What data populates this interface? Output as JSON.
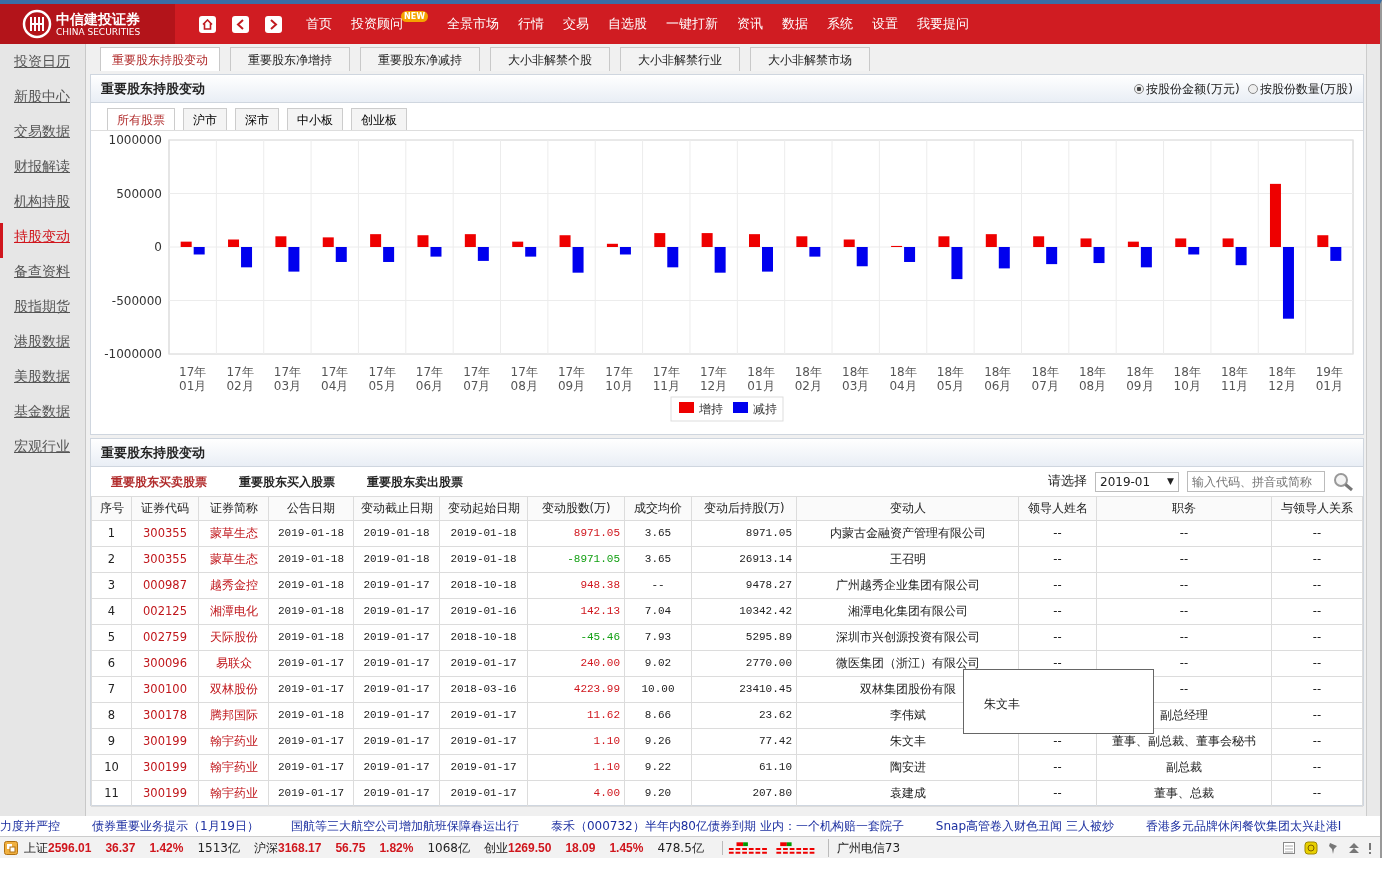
{
  "header": {
    "logo": {
      "name": "中信建投证券",
      "subtitle": "CHINA SECURITIES"
    },
    "nav": [
      {
        "label": "首页"
      },
      {
        "label": "投资顾问",
        "badge": "NEW"
      },
      {
        "label": "全景市场"
      },
      {
        "label": "行情"
      },
      {
        "label": "交易"
      },
      {
        "label": "自选股"
      },
      {
        "label": "一键打新"
      },
      {
        "label": "资讯"
      },
      {
        "label": "数据"
      },
      {
        "label": "系统"
      },
      {
        "label": "设置"
      },
      {
        "label": "我要提问"
      }
    ]
  },
  "sidebar": {
    "items": [
      {
        "label": "投资日历",
        "selected": false
      },
      {
        "label": "新股中心",
        "selected": false
      },
      {
        "label": "交易数据",
        "selected": false
      },
      {
        "label": "财报解读",
        "selected": false
      },
      {
        "label": "机构持股",
        "selected": false
      },
      {
        "label": "持股变动",
        "selected": true
      },
      {
        "label": "备查资料",
        "selected": false
      },
      {
        "label": "股指期货",
        "selected": false
      },
      {
        "label": "港股数据",
        "selected": false
      },
      {
        "label": "美股数据",
        "selected": false
      },
      {
        "label": "基金数据",
        "selected": false
      },
      {
        "label": "宏观行业",
        "selected": false
      }
    ]
  },
  "tabs": [
    {
      "label": "重要股东持股变动",
      "selected": true
    },
    {
      "label": "重要股东净增持",
      "selected": false
    },
    {
      "label": "重要股东净减持",
      "selected": false
    },
    {
      "label": "大小非解禁个股",
      "selected": false
    },
    {
      "label": "大小非解禁行业",
      "selected": false
    },
    {
      "label": "大小非解禁市场",
      "selected": false
    }
  ],
  "chart_panel": {
    "title": "重要股东持股变动",
    "options": [
      {
        "label": "按股份金额(万元)",
        "selected": true
      },
      {
        "label": "按股份数量(万股)",
        "selected": false
      }
    ],
    "market_tabs": [
      {
        "label": "所有股票",
        "selected": true
      },
      {
        "label": "沪市",
        "selected": false
      },
      {
        "label": "深市",
        "selected": false
      },
      {
        "label": "中小板",
        "selected": false
      },
      {
        "label": "创业板",
        "selected": false
      }
    ],
    "chart_data": {
      "type": "bar",
      "categories": [
        "17年01月",
        "17年02月",
        "17年03月",
        "17年04月",
        "17年05月",
        "17年06月",
        "17年07月",
        "17年08月",
        "17年09月",
        "17年10月",
        "17年11月",
        "17年12月",
        "18年01月",
        "18年02月",
        "18年03月",
        "18年04月",
        "18年05月",
        "18年06月",
        "18年07月",
        "18年08月",
        "18年09月",
        "18年10月",
        "18年11月",
        "18年12月",
        "19年01月"
      ],
      "series": [
        {
          "name": "增持",
          "color": "#ee0000",
          "values": [
            50000,
            70000,
            100000,
            90000,
            120000,
            110000,
            120000,
            50000,
            110000,
            30000,
            130000,
            130000,
            120000,
            100000,
            70000,
            10000,
            100000,
            120000,
            100000,
            80000,
            50000,
            80000,
            80000,
            590000,
            110000
          ]
        },
        {
          "name": "减持",
          "color": "#0000ee",
          "values": [
            -70000,
            -190000,
            -230000,
            -140000,
            -140000,
            -90000,
            -130000,
            -90000,
            -240000,
            -70000,
            -190000,
            -240000,
            -230000,
            -90000,
            -180000,
            -140000,
            -300000,
            -200000,
            -160000,
            -150000,
            -190000,
            -70000,
            -170000,
            -670000,
            -130000
          ]
        }
      ],
      "ylim": [
        -1000000,
        1000000
      ],
      "yticks": [
        1000000,
        500000,
        0,
        -500000,
        -1000000
      ],
      "grid": true,
      "legend": true
    }
  },
  "table_panel": {
    "title": "重要股东持股变动",
    "filter_tabs": [
      {
        "label": "重要股东买卖股票",
        "selected": true
      },
      {
        "label": "重要股东买入股票",
        "selected": false
      },
      {
        "label": "重要股东卖出股票",
        "selected": false
      }
    ],
    "select_label": "请选择",
    "select_value": "2019-01",
    "select_caret": "▼",
    "search_placeholder": "输入代码、拼音或简称",
    "columns": [
      "序号",
      "证券代码",
      "证券简称",
      "公告日期",
      "变动截止日期",
      "变动起始日期",
      "变动股数(万)",
      "成交均价",
      "变动后持股(万)",
      "变动人",
      "领导人姓名",
      "职务",
      "与领导人关系"
    ],
    "rows": [
      {
        "no": "1",
        "code": "300355",
        "name": "蒙草生态",
        "announce": "2019-01-18",
        "end": "2019-01-18",
        "start": "2019-01-18",
        "change": "8971.05",
        "kind": "increase",
        "price": "3.65",
        "after": "8971.05",
        "holder": "内蒙古金融资产管理有限公司",
        "leader": "--",
        "title": "--",
        "relation": "--"
      },
      {
        "no": "2",
        "code": "300355",
        "name": "蒙草生态",
        "announce": "2019-01-18",
        "end": "2019-01-18",
        "start": "2019-01-18",
        "change": "-8971.05",
        "kind": "decrease",
        "price": "3.65",
        "after": "26913.14",
        "holder": "王召明",
        "leader": "--",
        "title": "--",
        "relation": "--"
      },
      {
        "no": "3",
        "code": "000987",
        "name": "越秀金控",
        "announce": "2019-01-18",
        "end": "2019-01-17",
        "start": "2018-10-18",
        "change": "948.38",
        "kind": "increase",
        "price": "--",
        "after": "9478.27",
        "holder": "广州越秀企业集团有限公司",
        "leader": "--",
        "title": "--",
        "relation": "--"
      },
      {
        "no": "4",
        "code": "002125",
        "name": "湘潭电化",
        "announce": "2019-01-18",
        "end": "2019-01-17",
        "start": "2019-01-16",
        "change": "142.13",
        "kind": "increase",
        "price": "7.04",
        "after": "10342.42",
        "holder": "湘潭电化集团有限公司",
        "leader": "--",
        "title": "--",
        "relation": "--"
      },
      {
        "no": "5",
        "code": "002759",
        "name": "天际股份",
        "announce": "2019-01-18",
        "end": "2019-01-17",
        "start": "2018-10-18",
        "change": "-45.46",
        "kind": "decrease",
        "price": "7.93",
        "after": "5295.89",
        "holder": "深圳市兴创源投资有限公司",
        "leader": "--",
        "title": "--",
        "relation": "--"
      },
      {
        "no": "6",
        "code": "300096",
        "name": "易联众",
        "announce": "2019-01-17",
        "end": "2019-01-17",
        "start": "2019-01-17",
        "change": "240.00",
        "kind": "increase",
        "price": "9.02",
        "after": "2770.00",
        "holder": "微医集团（浙江）有限公司",
        "leader": "--",
        "title": "--",
        "relation": "--"
      },
      {
        "no": "7",
        "code": "300100",
        "name": "双林股份",
        "announce": "2019-01-17",
        "end": "2019-01-17",
        "start": "2018-03-16",
        "change": "4223.99",
        "kind": "increase",
        "price": "10.00",
        "after": "23410.45",
        "holder": "双林集团股份有限",
        "title": "--",
        "relation": "--"
      },
      {
        "no": "8",
        "code": "300178",
        "name": "腾邦国际",
        "announce": "2019-01-18",
        "end": "2019-01-17",
        "start": "2019-01-17",
        "change": "11.62",
        "kind": "increase",
        "price": "8.66",
        "after": "23.62",
        "holder": "李伟斌",
        "title": "副总经理",
        "relation": "--"
      },
      {
        "no": "9",
        "code": "300199",
        "name": "翰宇药业",
        "announce": "2019-01-17",
        "end": "2019-01-17",
        "start": "2019-01-17",
        "change": "1.10",
        "kind": "increase",
        "price": "9.26",
        "after": "77.42",
        "holder": "朱文丰",
        "leader": "--",
        "title": "董事、副总裁、董事会秘书",
        "relation": "--"
      },
      {
        "no": "10",
        "code": "300199",
        "name": "翰宇药业",
        "announce": "2019-01-17",
        "end": "2019-01-17",
        "start": "2019-01-17",
        "change": "1.10",
        "kind": "increase",
        "price": "9.22",
        "after": "61.10",
        "holder": "陶安进",
        "leader": "--",
        "title": "副总裁",
        "relation": "--"
      },
      {
        "no": "11",
        "code": "300199",
        "name": "翰宇药业",
        "announce": "2019-01-17",
        "end": "2019-01-17",
        "start": "2019-01-17",
        "change": "4.00",
        "kind": "increase",
        "price": "9.20",
        "after": "207.80",
        "holder": "袁建成",
        "leader": "--",
        "title": "董事、总裁",
        "relation": "--"
      }
    ],
    "tooltip": "朱文丰"
  },
  "news_ticker": [
    "力度并严控",
    "债券重要业务提示（1月19日）",
    "国航等三大航空公司增加航班保障春运出行",
    "泰禾（000732）半年内80亿债券到期 业内：一个机构赔一套院子",
    "Snap高管卷入财色丑闻 三人被炒",
    "香港多元品牌休闲餐饮集团太兴赴港I"
  ],
  "status_bar": {
    "indices": [
      {
        "name": "上证",
        "value": "2596.01",
        "change": "36.37",
        "percent": "1.42%",
        "turnover": "1513亿"
      },
      {
        "name": "沪深",
        "value": "3168.17",
        "change": "56.75",
        "percent": "1.82%",
        "turnover": "1068亿"
      },
      {
        "name": "创业",
        "value": "1269.50",
        "change": "18.09",
        "percent": "1.45%",
        "turnover": "478.5亿"
      }
    ],
    "connection": "广州电信73"
  }
}
